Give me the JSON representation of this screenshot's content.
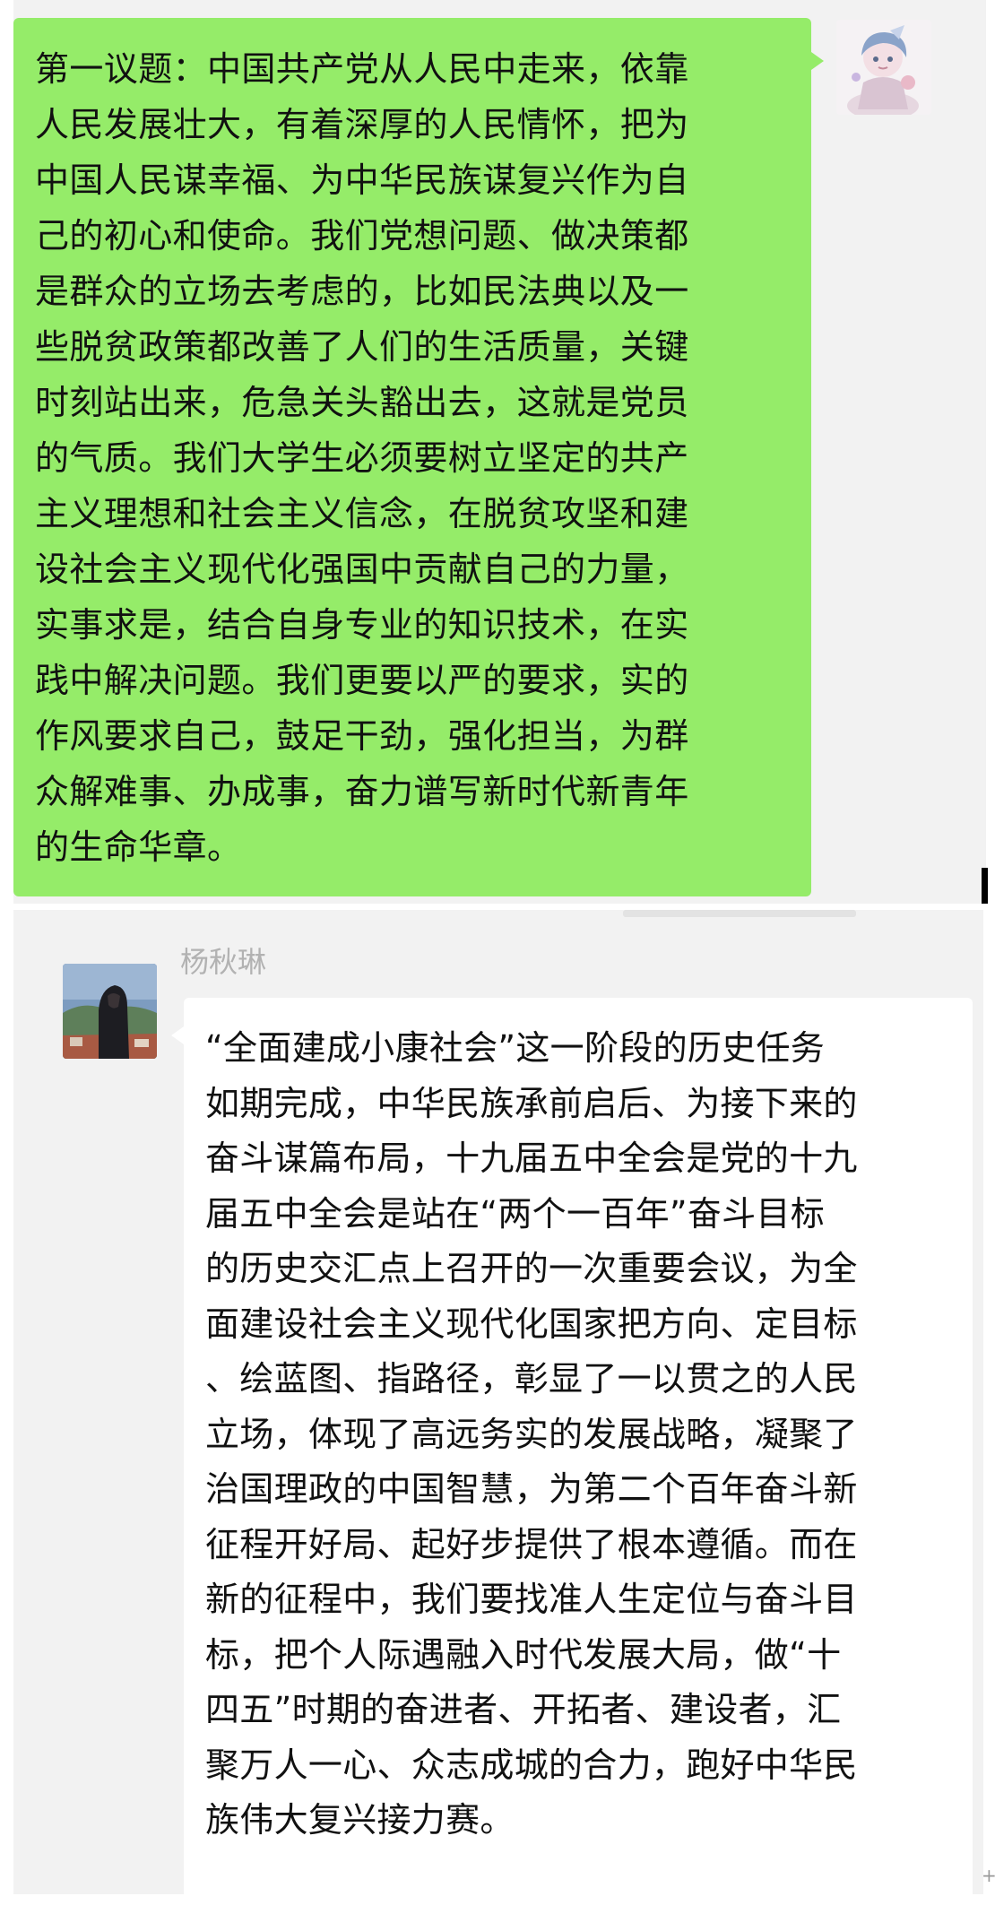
{
  "conversation": {
    "messages": [
      {
        "direction": "outgoing",
        "sender": "",
        "bubble_color": "#95ec69",
        "avatar_icon": "anime-character-avatar",
        "text": "第一议题：中国共产党从人民中走来，依靠\n人民发展壮大，有着深厚的人民情怀，把为\n中国人民谋幸福、为中华民族谋复兴作为自\n己的初心和使命。我们党想问题、做决策都\n是群众的立场去考虑的，比如民法典以及一\n些脱贫政策都改善了人们的生活质量，关键\n时刻站出来，危急关头豁出去，这就是党员\n的气质。我们大学生必须要树立坚定的共产\n主义理想和社会主义信念，在脱贫攻坚和建\n设社会主义现代化强国中贡献自己的力量，\n实事求是，结合自身专业的知识技术，在实\n践中解决问题。我们更要以严的要求，实的\n作风要求自己，鼓足干劲，强化担当，为群\n众解难事、办成事，奋力谱写新时代新青年\n的生命华章。"
      },
      {
        "direction": "incoming",
        "sender": "杨秋琳",
        "bubble_color": "#ffffff",
        "avatar_icon": "person-photo-avatar",
        "text": "“全面建成小康社会”这一阶段的历史任务\n如期完成，中华民族承前启后、为接下来的\n奋斗谋篇布局，十九届五中全会是党的十九\n届五中全会是站在“两个一百年”奋斗目标\n的历史交汇点上召开的一次重要会议，为全\n面建设社会主义现代化国家把方向、定目标\n、绘蓝图、指路径，彰显了一以贯之的人民\n立场，体现了高远务实的发展战略，凝聚了\n治国理政的中国智慧，为第二个百年奋斗新\n征程开好局、起好步提供了根本遵循。而在\n新的征程中，我们要找准人生定位与奋斗目\n标，把个人际遇融入时代发展大局，做“十\n四五”时期的奋进者、开拓者、建设者，汇\n聚万人一心、众志成城的合力，跑好中华民\n族伟大复兴接力赛。"
      }
    ]
  },
  "colors": {
    "chat_background": "#f2f2f2",
    "sender_name": "#b2b2b2",
    "text": "#111111"
  }
}
